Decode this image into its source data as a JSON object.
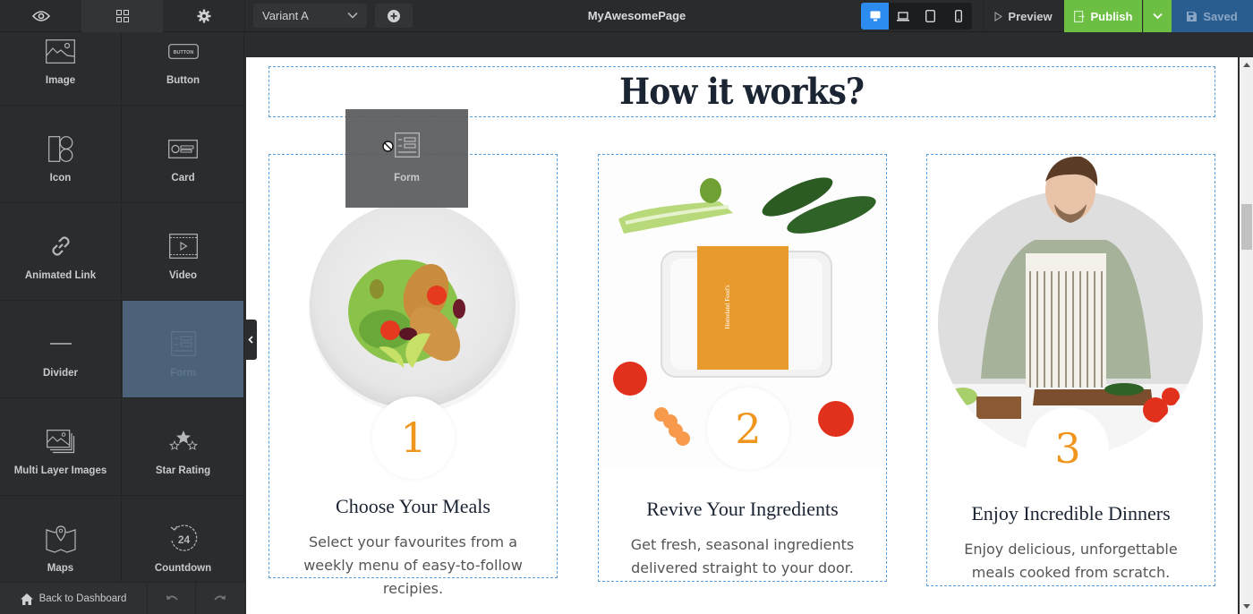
{
  "topbar": {
    "tabs": [
      {
        "icon": "eye-icon",
        "name": "preview-panel"
      },
      {
        "icon": "grid-icon",
        "name": "elements-panel",
        "active": true
      },
      {
        "icon": "gear-icon",
        "name": "settings-panel"
      }
    ],
    "variant": {
      "selected": "Variant A"
    },
    "page_title": "MyAwesomePage",
    "devices": [
      {
        "name": "desktop",
        "active": true
      },
      {
        "name": "laptop"
      },
      {
        "name": "tablet"
      },
      {
        "name": "mobile"
      }
    ],
    "preview_label": "Preview",
    "publish_label": "Publish",
    "saved_label": "Saved",
    "colors": {
      "publish": "#6cbf43",
      "saved": "#2a5d8f",
      "device_active": "#2d8cf0"
    }
  },
  "sidebar": {
    "elements": [
      {
        "label": "Image",
        "icon": "image-icon"
      },
      {
        "label": "Button",
        "icon": "button-icon",
        "icon_text": "BUTTON"
      },
      {
        "label": "Icon",
        "icon": "icon-element-icon"
      },
      {
        "label": "Card",
        "icon": "card-icon"
      },
      {
        "label": "Animated Link",
        "icon": "link-icon"
      },
      {
        "label": "Video",
        "icon": "video-icon"
      },
      {
        "label": "Divider",
        "icon": "divider-icon"
      },
      {
        "label": "Form",
        "icon": "form-icon",
        "selected": true
      },
      {
        "label": "Multi Layer Images",
        "icon": "multi-image-icon"
      },
      {
        "label": "Star Rating",
        "icon": "star-rating-icon"
      },
      {
        "label": "Maps",
        "icon": "map-icon"
      },
      {
        "label": "Countdown",
        "icon": "countdown-icon",
        "icon_text": "24"
      }
    ],
    "back_label": "Back to Dashboard"
  },
  "drag_ghost": {
    "label": "Form"
  },
  "canvas": {
    "heading": "How it works?",
    "steps": [
      {
        "number": "1",
        "title": "Choose Your Meals",
        "description": "Select your favourites from a weekly menu of easy-to-follow recipies.",
        "image": "salad-plate"
      },
      {
        "number": "2",
        "title": "Revive Your Ingredients",
        "description": "Get fresh, seasonal ingredients delivered straight to your door.",
        "image": "meal-box-vegetables",
        "box_label": "Homeland Food's"
      },
      {
        "number": "3",
        "title": "Enjoy Incredible Dinners",
        "description": "Enjoy delicious, unforgettable meals cooked from scratch.",
        "image": "man-cooking"
      }
    ],
    "accent_color": "#f0961e"
  }
}
